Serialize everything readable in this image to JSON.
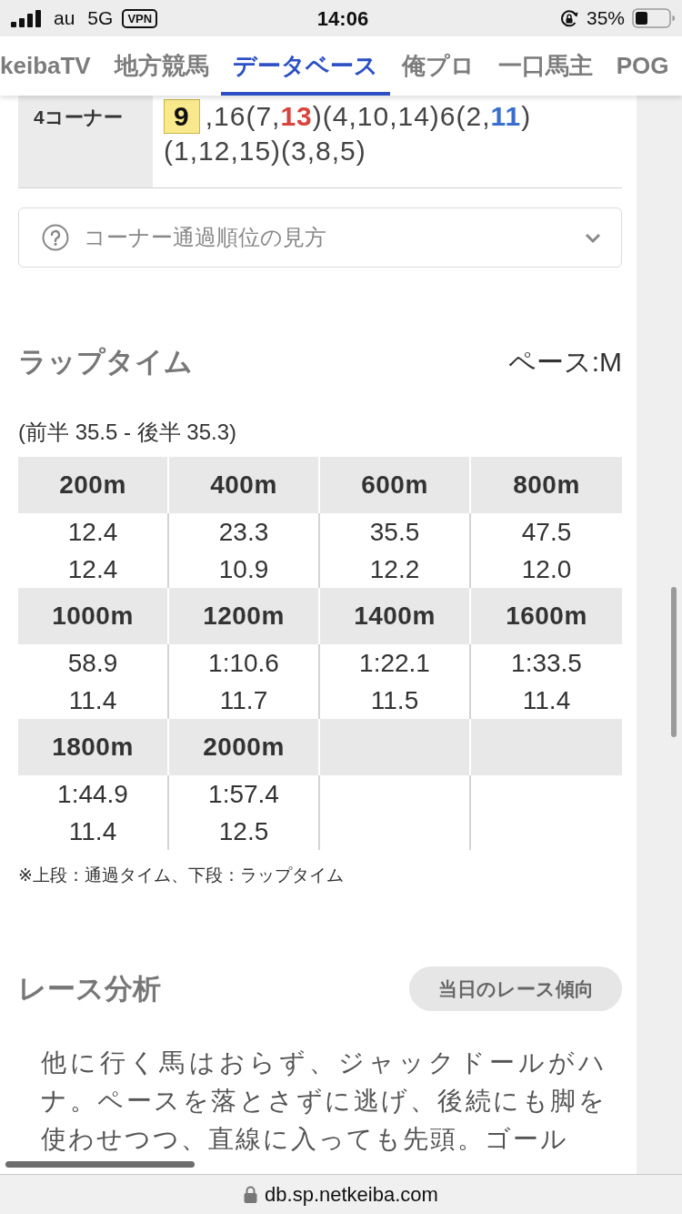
{
  "status_bar": {
    "carrier": "au",
    "network": "5G",
    "vpn": "VPN",
    "time": "14:06",
    "battery_percent": "35%"
  },
  "nav_tabs": [
    {
      "label": "keibaTV",
      "selected": false
    },
    {
      "label": "地方競馬",
      "selected": false
    },
    {
      "label": "データベース",
      "selected": true
    },
    {
      "label": "俺プロ",
      "selected": false
    },
    {
      "label": "一口馬主",
      "selected": false
    },
    {
      "label": "POG",
      "selected": false
    }
  ],
  "corner_passing": {
    "label": "4コーナー",
    "lines": [
      {
        "segments": [
          {
            "kind": "boxed",
            "text": "9"
          },
          {
            "kind": "plain",
            "text": ",16(7,"
          },
          {
            "kind": "colored",
            "text": "13",
            "color": "#d9433d"
          },
          {
            "kind": "plain",
            "text": ")(4,10,14)6(2,"
          },
          {
            "kind": "colored",
            "text": "11",
            "color": "#3a6fd1"
          },
          {
            "kind": "plain",
            "text": ")"
          }
        ]
      },
      {
        "segments": [
          {
            "kind": "plain",
            "text": "(1,12,15)(3,8,5)"
          }
        ]
      }
    ]
  },
  "help_accordion": {
    "label": "コーナー通過順位の見方",
    "expanded": false
  },
  "lap_time": {
    "title": "ラップタイム",
    "pace": "ペース:M",
    "halves": "(前半 35.5 - 後半 35.3)",
    "splits": [
      {
        "distance": "200m",
        "passing": "12.4",
        "lap": "12.4"
      },
      {
        "distance": "400m",
        "passing": "23.3",
        "lap": "10.9"
      },
      {
        "distance": "600m",
        "passing": "35.5",
        "lap": "12.2"
      },
      {
        "distance": "800m",
        "passing": "47.5",
        "lap": "12.0"
      },
      {
        "distance": "1000m",
        "passing": "58.9",
        "lap": "11.4"
      },
      {
        "distance": "1200m",
        "passing": "1:10.6",
        "lap": "11.7"
      },
      {
        "distance": "1400m",
        "passing": "1:22.1",
        "lap": "11.5"
      },
      {
        "distance": "1600m",
        "passing": "1:33.5",
        "lap": "11.4"
      },
      {
        "distance": "1800m",
        "passing": "1:44.9",
        "lap": "11.4"
      },
      {
        "distance": "2000m",
        "passing": "1:57.4",
        "lap": "12.5"
      }
    ],
    "note": "※上段：通過タイム、下段：ラップタイム"
  },
  "race_analysis": {
    "title": "レース分析",
    "trend_button": "当日のレース傾向",
    "text": "他に行く馬はおらず、ジャックドールがハナ。ペースを落とさずに逃げ、後続にも脚を使わせつつ、直線に入っても先頭。ゴール"
  },
  "address_bar": {
    "url": "db.sp.netkeiba.com"
  }
}
